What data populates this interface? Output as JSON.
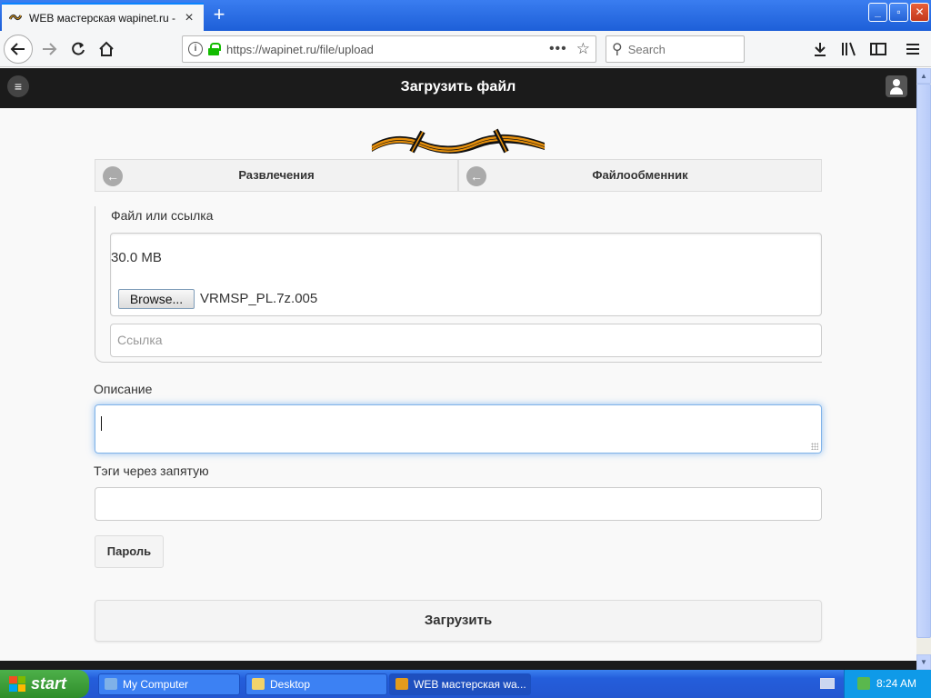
{
  "browser": {
    "tab_title": "WEB мастерская wapinet.ru - Загрузить файл",
    "tab_close": "×",
    "new_tab": "+",
    "url": "https://wapinet.ru/file/upload",
    "search_placeholder": "Search",
    "win_min": "_",
    "win_max": "▫",
    "win_close": "✕"
  },
  "site": {
    "title": "Загрузить файл",
    "menu_icon": "≡"
  },
  "breadcrumbs": [
    {
      "label": "Развлечения",
      "icon": "arrow-left-icon"
    },
    {
      "label": "Файлообменник",
      "icon": "arrow-left-icon"
    }
  ],
  "form": {
    "file_legend": "Файл или ссылка",
    "max_size": "30.0 MB",
    "browse_label": "Browse...",
    "selected_file": "VRMSP_PL.7z.005",
    "link_placeholder": "Ссылка",
    "description_label": "Описание",
    "description_value": "",
    "tags_label": "Тэги через запятую",
    "tags_value": "",
    "password_button": "Пароль",
    "submit_button": "Загрузить"
  },
  "taskbar": {
    "start_label": "start",
    "items": [
      {
        "label": "My Computer",
        "active": false
      },
      {
        "label": "Desktop",
        "active": false
      },
      {
        "label": "WEB мастерская wa...",
        "active": true
      }
    ],
    "clock": "8:24 AM"
  },
  "colors": {
    "header_bg": "#1b1b1b",
    "focus_glow": "#388ee9",
    "secure_lock": "#12bc00",
    "taskbar_blue": "#245edb",
    "start_green": "#2f8d2a"
  }
}
